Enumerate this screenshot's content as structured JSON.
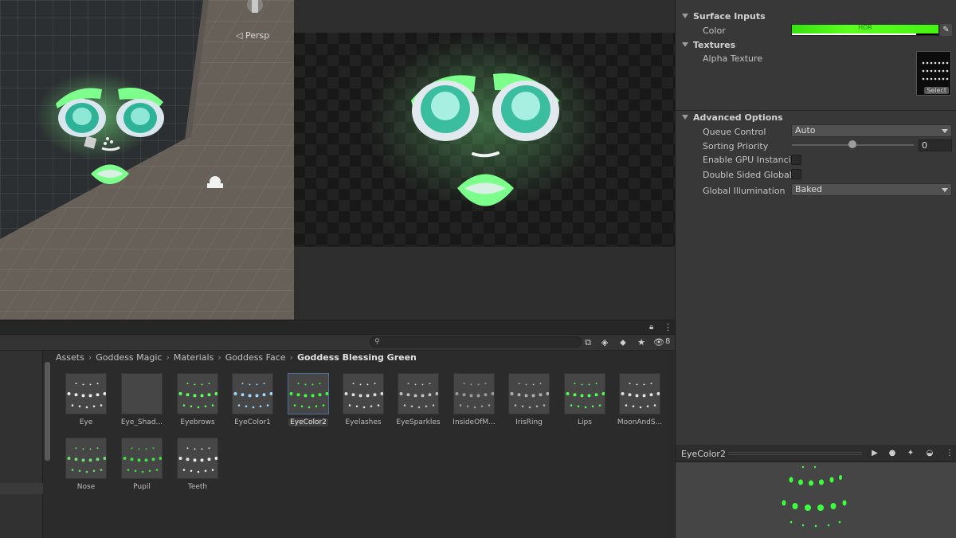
{
  "scene": {
    "projection_label": "◁ Persp"
  },
  "inspector": {
    "surface_inputs": {
      "header": "Surface Inputs",
      "color_label": "Color",
      "color_value": "#44f012",
      "hdr_badge": "HDR"
    },
    "textures": {
      "header": "Textures",
      "alpha_texture_label": "Alpha Texture",
      "select_label": "Select"
    },
    "advanced": {
      "header": "Advanced Options",
      "queue_control_label": "Queue Control",
      "queue_control_value": "Auto",
      "sorting_priority_label": "Sorting Priority",
      "sorting_priority_value": "0",
      "gpu_instancing_label": "Enable GPU Instancing",
      "double_sided_gi_label": "Double Sided Global Il",
      "global_illumination_label": "Global Illumination",
      "global_illumination_value": "Baked"
    }
  },
  "project": {
    "search_placeholder": "",
    "hidden_count": "8",
    "breadcrumb": [
      "Assets",
      "Goddess Magic",
      "Materials",
      "Goddess Face",
      "Goddess Blessing Green"
    ],
    "assets": [
      {
        "name": "Eye",
        "dot_color": "#e8e8e8"
      },
      {
        "name": "Eye_Shad...",
        "dot_color": ""
      },
      {
        "name": "Eyebrows",
        "dot_color": "#5dff5a"
      },
      {
        "name": "EyeColor1",
        "dot_color": "#9fd8ff"
      },
      {
        "name": "EyeColor2",
        "dot_color": "#3dff3d"
      },
      {
        "name": "Eyelashes",
        "dot_color": "#dcdcdc"
      },
      {
        "name": "EyeSparkles",
        "dot_color": "#bdbdbd"
      },
      {
        "name": "InsideOfM...",
        "dot_color": "#9a9a9a"
      },
      {
        "name": "IrisRing",
        "dot_color": "#b0b0b0"
      },
      {
        "name": "Lips",
        "dot_color": "#4dff4d"
      },
      {
        "name": "MoonAndS...",
        "dot_color": "#e0e0e0"
      },
      {
        "name": "Nose",
        "dot_color": "#6fdc6f"
      },
      {
        "name": "Pupil",
        "dot_color": "#3ce23c"
      },
      {
        "name": "Teeth",
        "dot_color": "#e6e6e6"
      }
    ],
    "selected_asset": "EyeColor2"
  },
  "preview": {
    "title": "EyeColor2"
  },
  "colors": {
    "accent_green": "#7dff8c",
    "panel_bg": "#383838"
  }
}
